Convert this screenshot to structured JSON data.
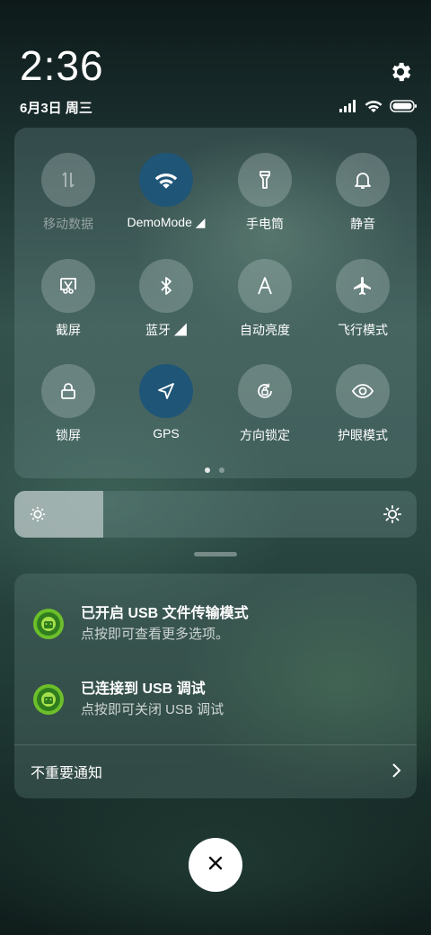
{
  "status_bar": {
    "time": "2:36",
    "date": "6月3日 周三",
    "icons": [
      "signal-icon",
      "wifi-icon",
      "battery-icon"
    ]
  },
  "quick_settings": {
    "tiles": [
      {
        "label": "移动数据",
        "icon": "mobile-data-icon",
        "active": false,
        "disabled": true
      },
      {
        "label": "DemoMode ◢",
        "icon": "wifi-icon",
        "active": true
      },
      {
        "label": "手电筒",
        "icon": "flashlight-icon",
        "active": false
      },
      {
        "label": "静音",
        "icon": "bell-icon",
        "active": false
      },
      {
        "label": "截屏",
        "icon": "screenshot-icon",
        "active": false
      },
      {
        "label": "蓝牙 ◢",
        "icon": "bluetooth-icon",
        "active": false
      },
      {
        "label": "自动亮度",
        "icon": "auto-brightness-icon",
        "active": false
      },
      {
        "label": "飞行模式",
        "icon": "airplane-icon",
        "active": false
      },
      {
        "label": "锁屏",
        "icon": "lock-icon",
        "active": false
      },
      {
        "label": "GPS",
        "icon": "gps-icon",
        "active": true
      },
      {
        "label": "方向锁定",
        "icon": "rotation-lock-icon",
        "active": false
      },
      {
        "label": "护眼模式",
        "icon": "eye-icon",
        "active": false
      }
    ],
    "page_count": 2,
    "current_page": 1
  },
  "brightness": {
    "level": 0.22
  },
  "notifications": {
    "items": [
      {
        "title": "已开启 USB 文件传输模式",
        "body": "点按即可查看更多选项。",
        "icon": "android-system-icon"
      },
      {
        "title": "已连接到 USB 调试",
        "body": "点按即可关闭 USB 调试",
        "icon": "android-system-icon"
      }
    ],
    "unimportant_label": "不重要通知"
  },
  "colors": {
    "active_tile": "#1f5577",
    "inactive_tile": "rgba(200,215,215,0.28)"
  }
}
